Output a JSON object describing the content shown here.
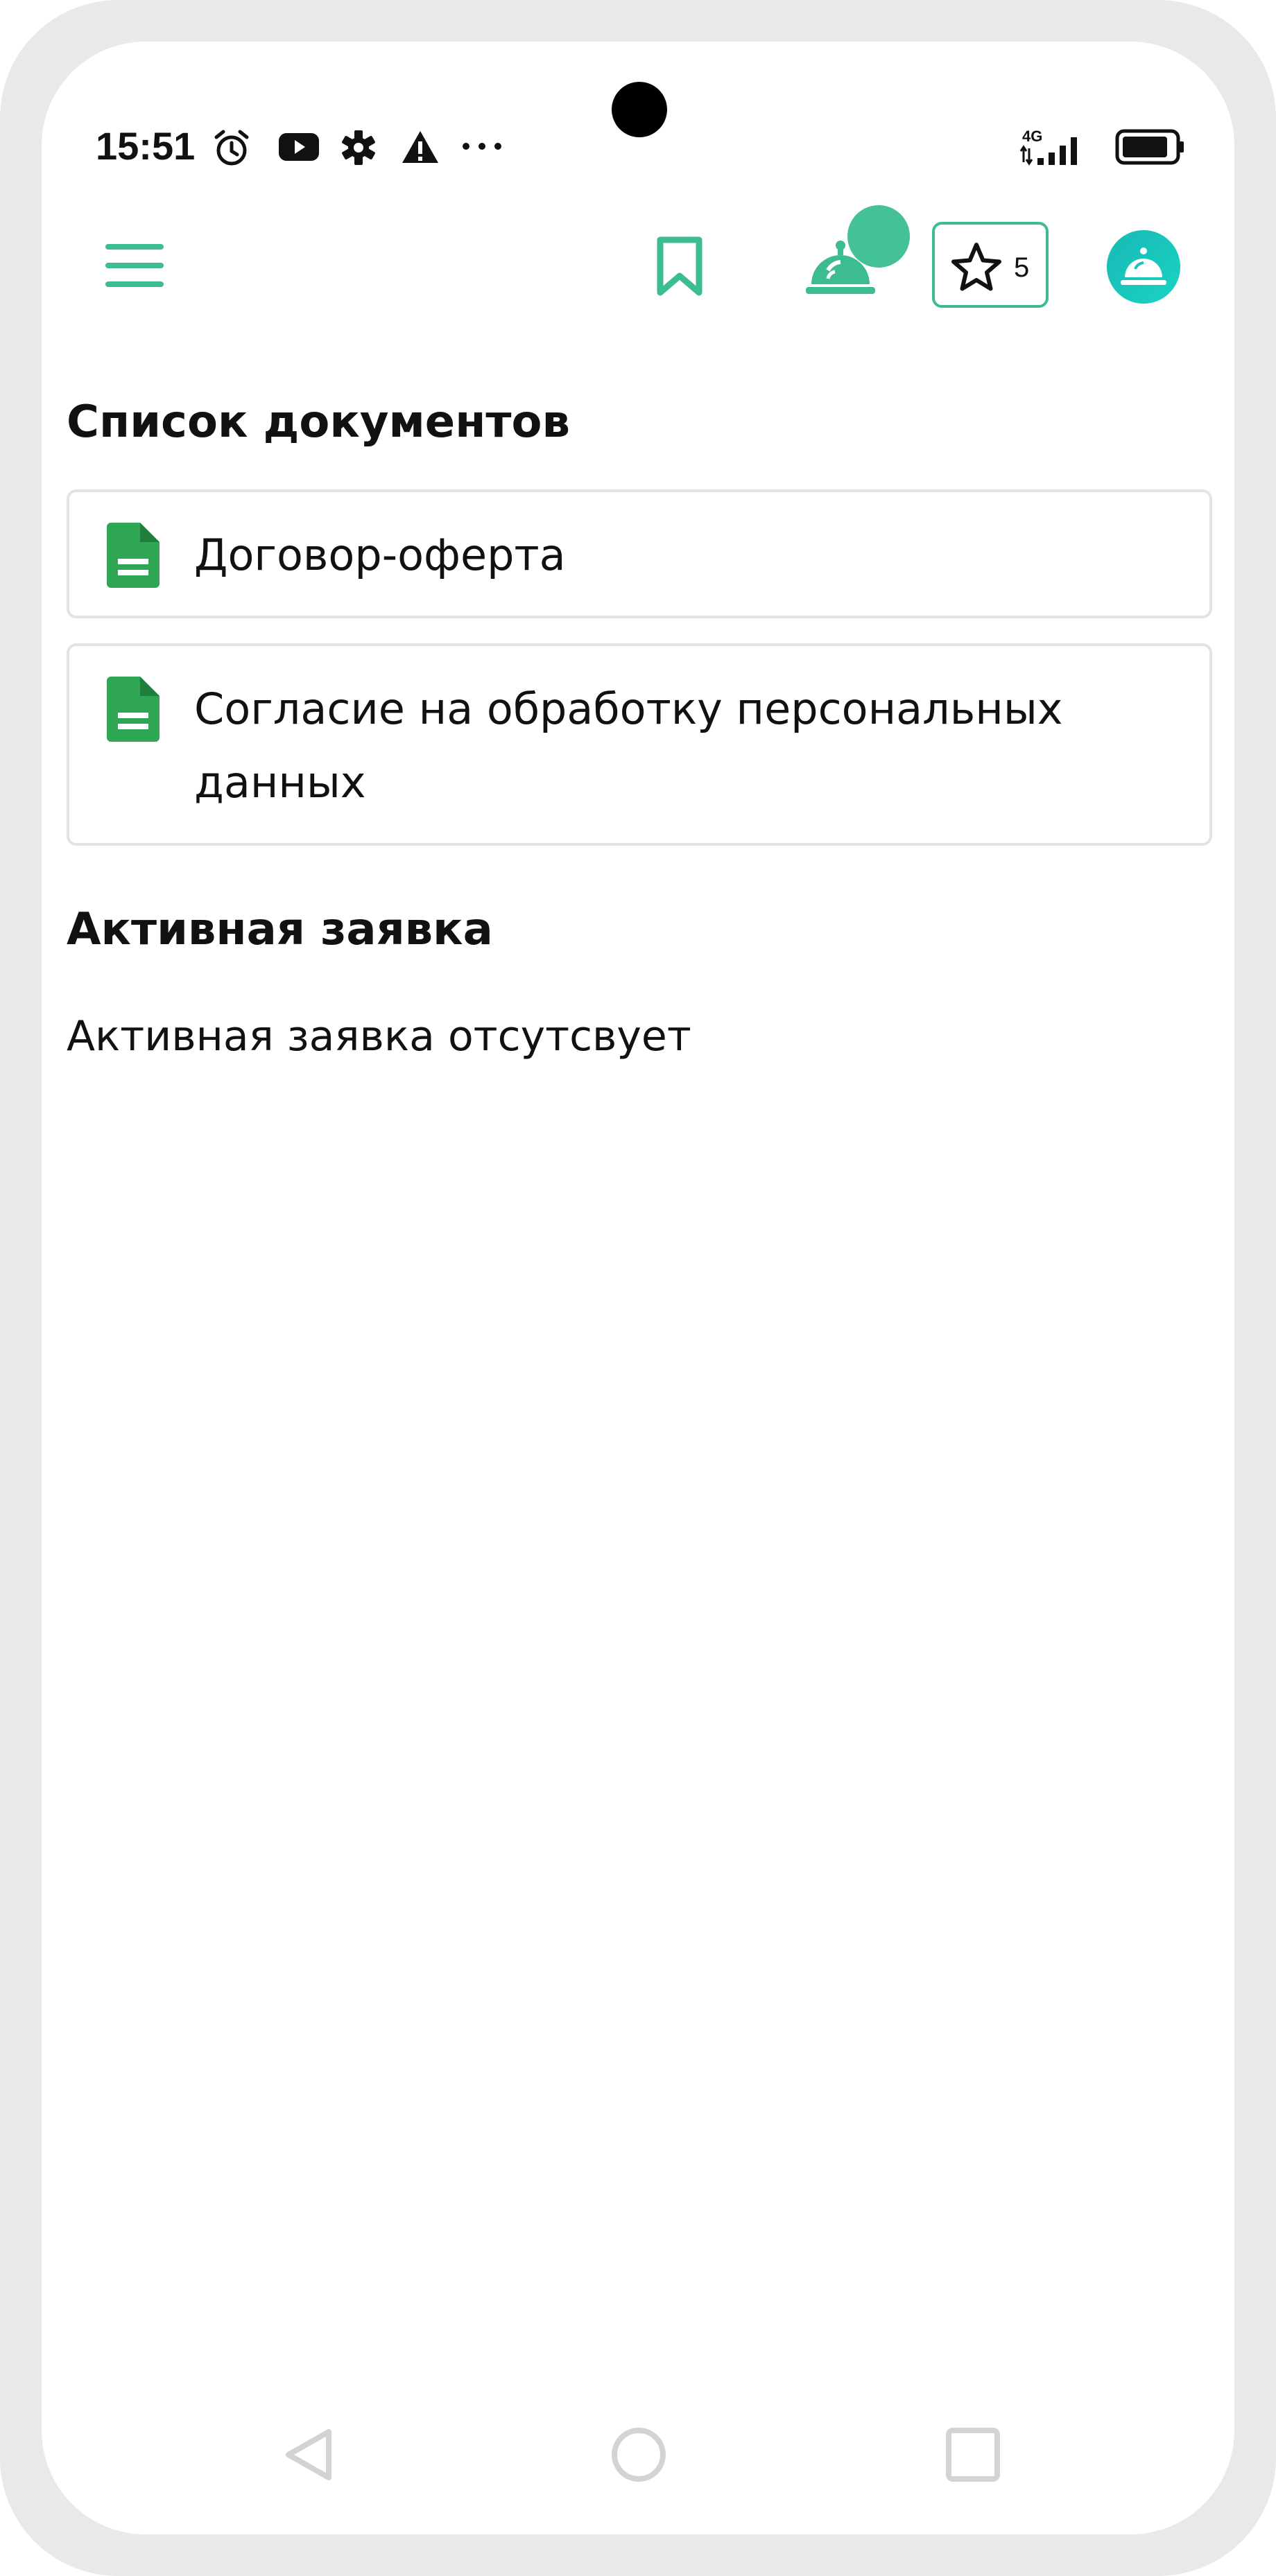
{
  "status_bar": {
    "time": "15:51",
    "network": "4G",
    "icons": [
      "alarm-icon",
      "youtube-icon",
      "gear-icon",
      "warning-icon",
      "more-dots-icon",
      "signal-icon",
      "battery-icon"
    ]
  },
  "header": {
    "icons": [
      "menu-icon",
      "bookmark-icon",
      "service-bell-icon",
      "star-icon"
    ],
    "rating_count": "5",
    "accent_color": "#3dbd8f"
  },
  "documents": {
    "title": "Список документов",
    "items": [
      {
        "label": "Договор-оферта",
        "icon": "document-icon"
      },
      {
        "label_line1": "Согласие на обработку персональных",
        "label_line2": "данных",
        "icon": "document-icon"
      }
    ]
  },
  "active_request": {
    "title": "Активная заявка",
    "empty_text": "Активная заявка отсутсвует"
  },
  "nav_bar": {
    "icons": [
      "back-icon",
      "home-icon",
      "recents-icon"
    ]
  }
}
